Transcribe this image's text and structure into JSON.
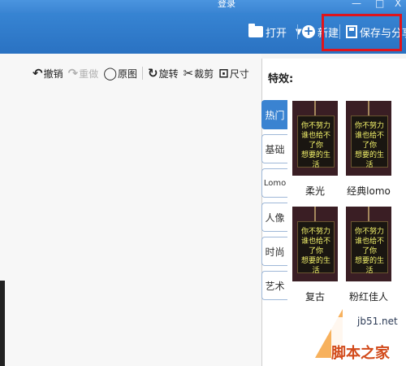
{
  "titlebar": {
    "login_label": "登录",
    "win_controls": [
      "—",
      "□",
      "X"
    ]
  },
  "toolbar_top": {
    "open_label": "打开",
    "open_dropdown": "▼",
    "new_label": "新建",
    "save_label": "保存与分享"
  },
  "edit_tools": [
    {
      "label": "撤销",
      "glyph": "↶",
      "disabled": false
    },
    {
      "label": "重做",
      "glyph": "↷",
      "disabled": true
    },
    {
      "label": "原图",
      "glyph": "◯",
      "disabled": false
    },
    {
      "label": "旋转",
      "glyph": "↻",
      "disabled": false
    },
    {
      "label": "裁剪",
      "glyph": "✂",
      "disabled": false
    },
    {
      "label": "尺寸",
      "glyph": "⊡",
      "disabled": false
    }
  ],
  "panel": {
    "title": "特效:",
    "tabs": [
      {
        "label": "热门",
        "active": true
      },
      {
        "label": "基础",
        "active": false
      },
      {
        "label": "Lomo",
        "active": false
      },
      {
        "label": "人像",
        "active": false
      },
      {
        "label": "时尚",
        "active": false
      },
      {
        "label": "艺术",
        "active": false
      }
    ],
    "effects": [
      {
        "label": "柔光"
      },
      {
        "label": "经典lomo"
      },
      {
        "label": "复古"
      },
      {
        "label": "粉红佳人"
      }
    ],
    "thumb_text": [
      "你不努力",
      "谁也给不了你",
      "想要的生活"
    ]
  },
  "watermark": {
    "url": "jb51.net",
    "logo_text": "脚本之家"
  },
  "colors": {
    "titlebar": "#2a72c2",
    "active_tab": "#3a83d1",
    "highlight_box": "#e0141b"
  }
}
